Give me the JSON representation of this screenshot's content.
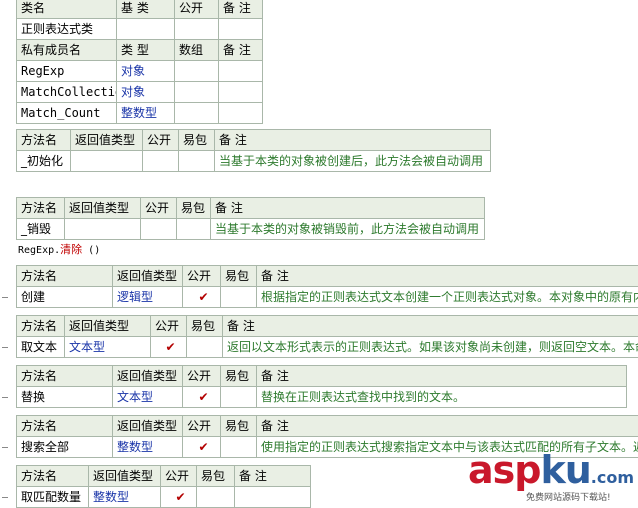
{
  "class_table": {
    "rows": [
      [
        "类名",
        "基 类",
        "公开",
        "备 注"
      ],
      [
        "正则表达式类",
        "",
        "",
        ""
      ],
      [
        "私有成员名",
        "类 型",
        "数组",
        "备 注"
      ],
      [
        "RegExp",
        "对象",
        "",
        ""
      ],
      [
        "MatchCollection",
        "对象",
        "",
        ""
      ],
      [
        "Match_Count",
        "整数型",
        "",
        ""
      ]
    ]
  },
  "init_table": {
    "headers": [
      "方法名",
      "返回值类型",
      "公开",
      "易包",
      "备 注"
    ],
    "row": [
      "_初始化",
      "",
      "",
      "",
      "当基于本类的对象被创建后，此方法会被自动调用"
    ]
  },
  "destroy_table": {
    "headers": [
      "方法名",
      "返回值类型",
      "公开",
      "易包",
      "备 注"
    ],
    "row": [
      "_销毁",
      "",
      "",
      "",
      "当基于本类的对象被销毁前，此方法会被自动调用"
    ]
  },
  "command": {
    "obj": "RegExp.",
    "method": "清除",
    "args": " ()"
  },
  "method_tables": [
    {
      "headers": [
        "方法名",
        "返回值类型",
        "公开",
        "易包",
        "备 注"
      ],
      "row": [
        "创建",
        "逻辑型",
        "✔",
        "",
        "根据指定的正则表达式文本创建一个正则表达式对象。本对象中的原有内容"
      ]
    },
    {
      "headers": [
        "方法名",
        "返回值类型",
        "公开",
        "易包",
        "备 注"
      ],
      "row": [
        "取文本",
        "文本型",
        "✔",
        "",
        "返回以文本形式表示的正则表达式。如果该对象尚未创建，则返回空文本。本命令"
      ]
    },
    {
      "headers": [
        "方法名",
        "返回值类型",
        "公开",
        "易包",
        "备 注"
      ],
      "row": [
        "替换",
        "文本型",
        "✔",
        "",
        "替换在正则表达式查找中找到的文本。"
      ]
    },
    {
      "headers": [
        "方法名",
        "返回值类型",
        "公开",
        "易包",
        "备 注"
      ],
      "row": [
        "搜索全部",
        "整数型",
        "✔",
        "",
        "使用指定的正则表达式搜索指定文本中与该表达式匹配的所有子文本。返"
      ]
    },
    {
      "headers": [
        "方法名",
        "返回值类型",
        "公开",
        "易包",
        "备 注"
      ],
      "row": [
        "取匹配数量",
        "整数型",
        "✔",
        "",
        ""
      ]
    }
  ],
  "watermark": {
    "text_a": "asp",
    "text_b": "ku",
    "suffix": ".com",
    "tagline": "免费网站源码下载站!"
  },
  "colors": {
    "header_bg": "#e9efe4",
    "border": "#a9b7a9",
    "type_blue": "#1a35a8",
    "note_green": "#2d7a2d",
    "check_red": "#b30000"
  }
}
